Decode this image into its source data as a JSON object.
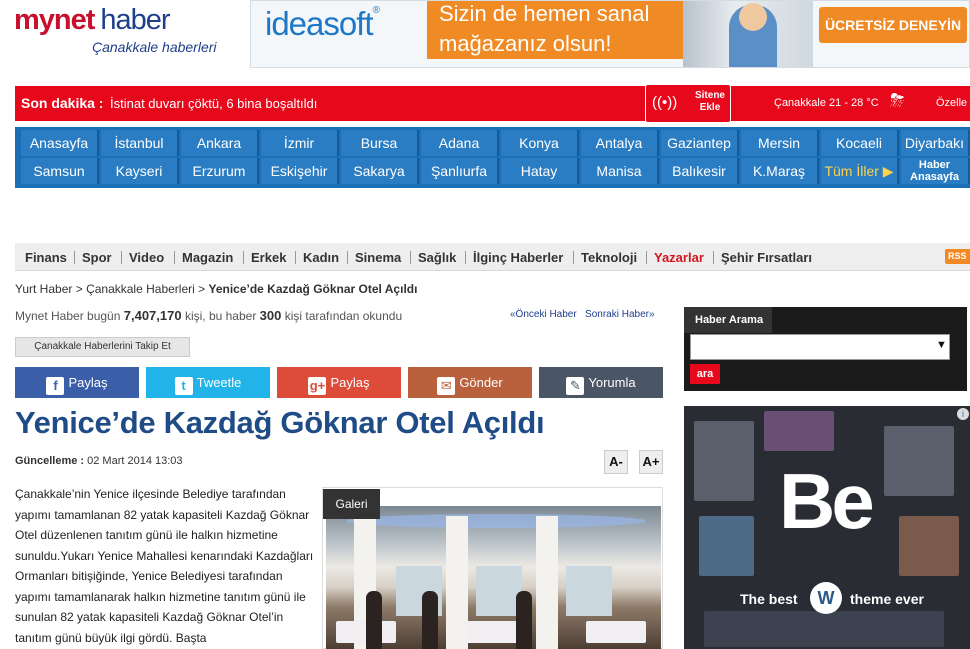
{
  "header": {
    "logo_brand": "mynet",
    "logo_haber": "haber",
    "logo_sub": "Çanakkale haberleri",
    "ad": {
      "brand": "ideasoft",
      "slogan": "Sizin de hemen sanal mağazanız olsun!",
      "cta": "ÜCRETSİZ DENEYİN"
    }
  },
  "breaking": {
    "label": "Son dakika :",
    "text": "İstinat duvarı çöktü, 6 bina boşaltıldı",
    "site_add": "Sitene Ekle",
    "weather": "Çanakkale 21 - 28 °C",
    "extra": "Özelle"
  },
  "cities": {
    "row1": [
      "Anasayfa",
      "İstanbul",
      "Ankara",
      "İzmir",
      "Bursa",
      "Adana",
      "Konya",
      "Antalya",
      "Gaziantep",
      "Mersin",
      "Kocaeli",
      "Diyarbakı"
    ],
    "row2": [
      "Samsun",
      "Kayseri",
      "Erzurum",
      "Eskişehir",
      "Sakarya",
      "Şanlıurfa",
      "Hatay",
      "Manisa",
      "Balıkesir",
      "K.Maraş",
      "Tüm İller",
      "Haber Anasayfa"
    ]
  },
  "categories": [
    "Finans",
    "Spor",
    "Video",
    "Magazin",
    "Erkek",
    "Kadın",
    "Sinema",
    "Sağlık",
    "İlginç Haberler",
    "Teknoloji",
    "Yazarlar",
    "Şehir Fırsatları"
  ],
  "rss": "RSS",
  "breadcrumb": {
    "home": "Yurt Haber",
    "section": "Çanakkale Haberleri",
    "current": "Yenice’de Kazdağ Göknar Otel Açıldı"
  },
  "readcount": {
    "prefix": "Mynet Haber bugün",
    "total": "7,407,170",
    "middle": "kişi, bu haber",
    "count": "300",
    "suffix": "kişi tarafından okundu"
  },
  "prevnext": {
    "prev": "«Önceki Haber",
    "next": "Sonraki Haber»"
  },
  "follow": "Çanakkale Haberlerini Takip Et",
  "share": {
    "facebook": "Paylaş",
    "twitter": "Tweetle",
    "gplus": "Paylaş",
    "email": "Gönder",
    "comment": "Yorumla"
  },
  "article": {
    "headline": "Yenice’de Kazdağ Göknar Otel Açıldı",
    "updated_label": "Güncelleme :",
    "updated_value": "02 Mart 2014 13:03",
    "font_decrease": "A-",
    "font_increase": "A+",
    "body": "Çanakkale’nin Yenice ilçesinde Belediye tarafından yapımı tamamlanan 82 yatak kapasiteli Kazdağ Göknar Otel düzenlenen tanıtım günü ile halkın hizmetine sunuldu.Yukarı Yenice Mahallesi kenarındaki Kazdağları Ormanları bitişiğinde, Yenice Belediyesi tarafından yapımı tamamlanarak halkın hizmetine tanıtım günü ile sunulan 82 yatak kapasiteli Kazdağ Göknar Otel’in tanıtım günü büyük ilgi gördü. Başta",
    "gallery_label": "Galeri"
  },
  "search": {
    "tab": "Haber Arama",
    "value": "",
    "button": "ara"
  },
  "side_ad": {
    "mark": "Be",
    "caption_left": "The best",
    "caption_right": "theme ever"
  },
  "colors": {
    "brand_red": "#e8081c",
    "brand_blue": "#1b6fb6",
    "headline_blue": "#1f4b87",
    "facebook": "#3b5ea8",
    "twitter": "#22b3e8",
    "gplus": "#dd4b39",
    "email": "#b9603c",
    "comment": "#4a5566"
  }
}
